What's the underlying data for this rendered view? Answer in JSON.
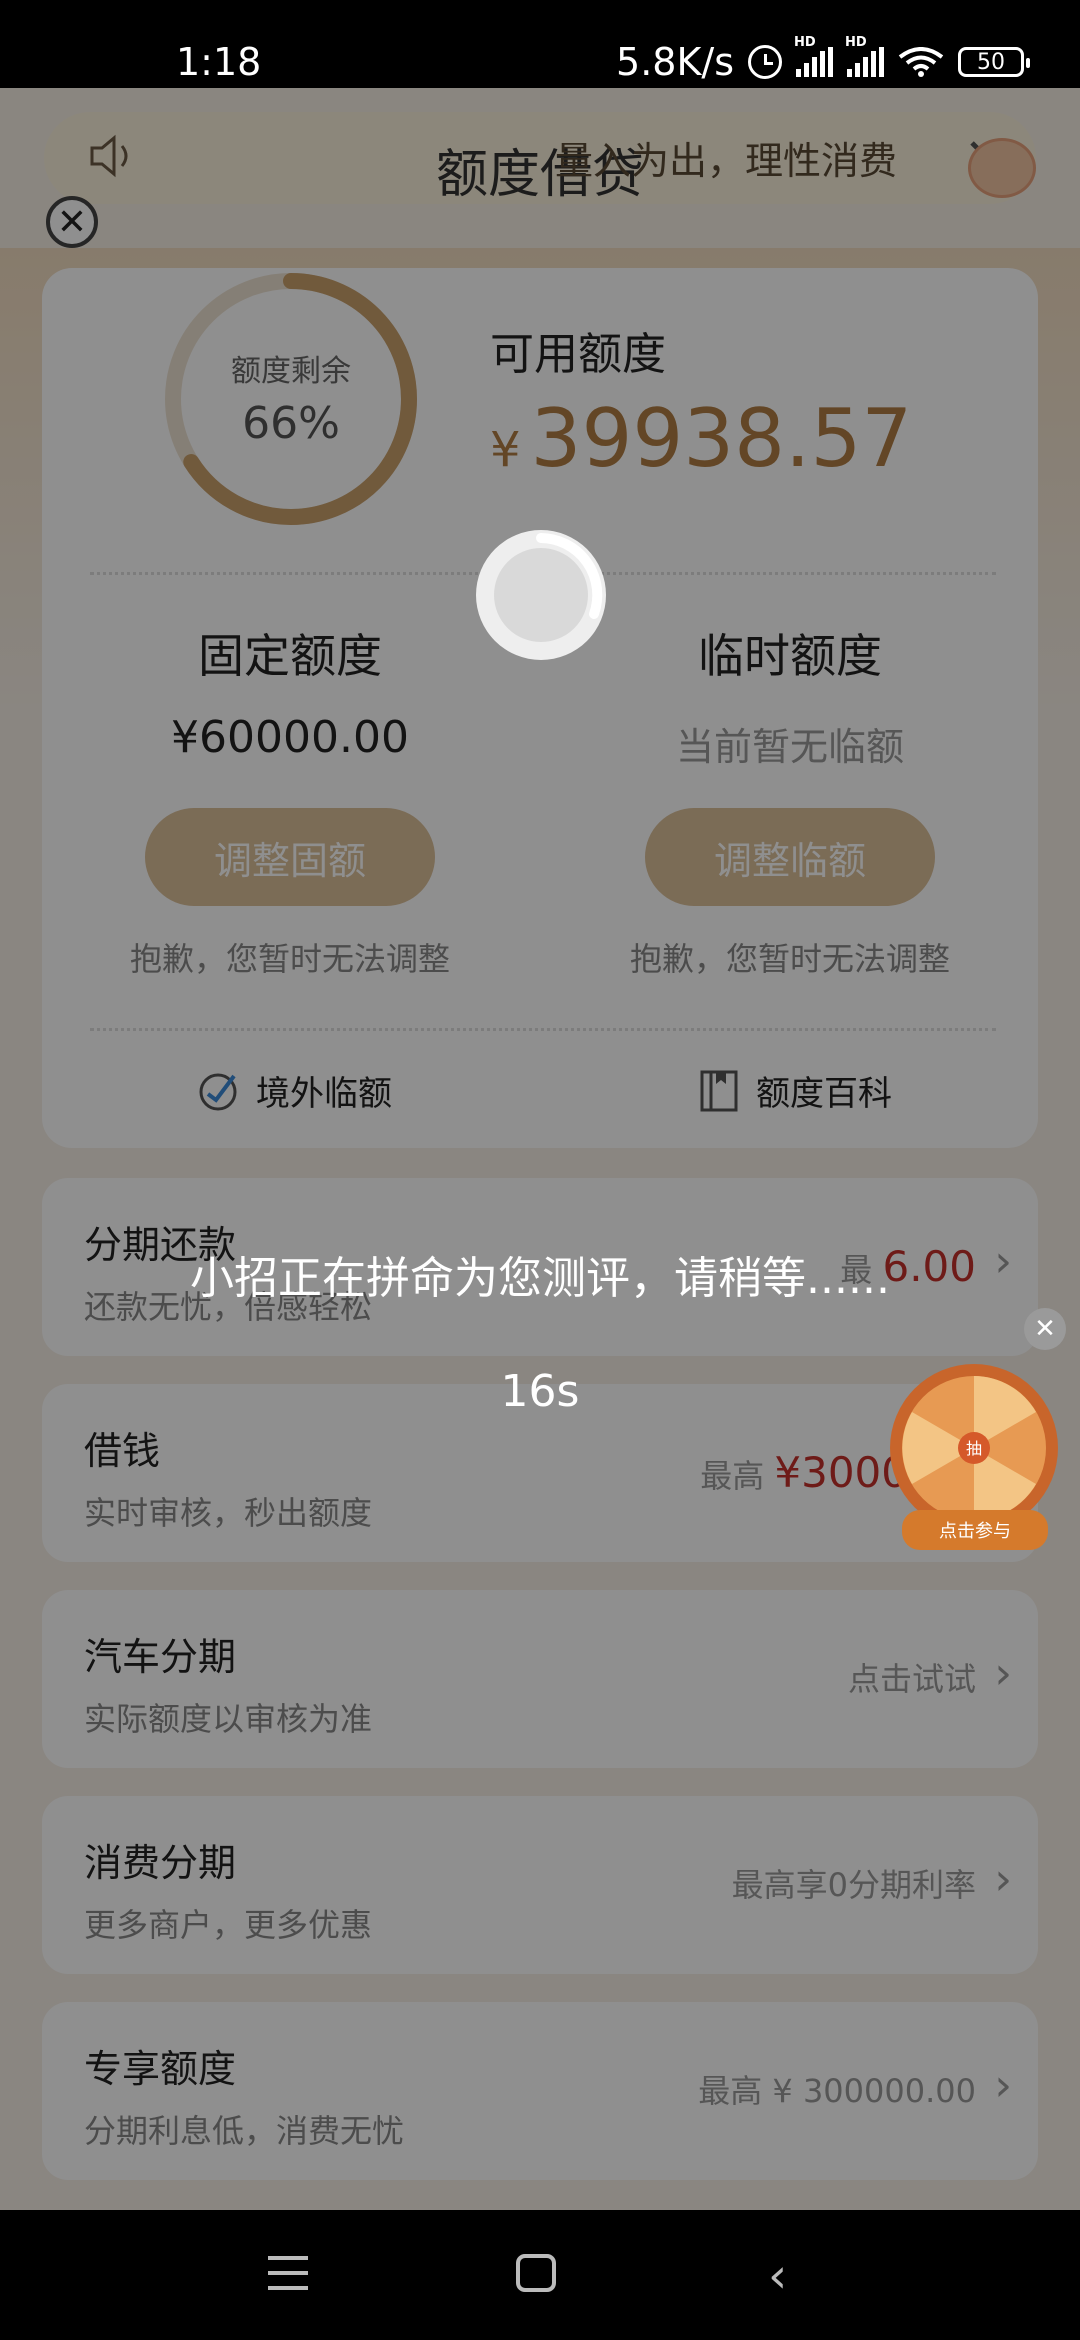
{
  "status_bar": {
    "time": "1:18",
    "net_speed": "5.8K/s",
    "battery": "50",
    "hd_label": "HD"
  },
  "header": {
    "title": "额度借贷",
    "notice": "量入为出，理性消费"
  },
  "quota": {
    "ring_label": "额度剩余",
    "ring_value": "66%",
    "ring_fraction": 0.66,
    "available_title": "可用额度",
    "available_currency": "¥",
    "available_value": "39938.57",
    "fixed": {
      "title": "固定额度",
      "value": "¥60000.00",
      "button": "调整固额",
      "note": "抱歉，您暂时无法调整"
    },
    "temporary": {
      "title": "临时额度",
      "value": "当前暂无临额",
      "button": "调整临额",
      "note": "抱歉，您暂时无法调整"
    },
    "shortcuts": {
      "overseas": "境外临额",
      "encyclopedia": "额度百科"
    }
  },
  "menu": [
    {
      "title": "分期还款",
      "subtitle": "还款无忧，倍感轻松",
      "right_prefix": "最",
      "right_value": "6.00"
    },
    {
      "title": "借钱",
      "subtitle": "实时审核，秒出额度",
      "right_prefix": "最高",
      "right_value": "¥3000"
    },
    {
      "title": "汽车分期",
      "subtitle": "实际额度以审核为准",
      "right_prefix": "点击试试",
      "right_value": ""
    },
    {
      "title": "消费分期",
      "subtitle": "更多商户，更多优惠",
      "right_prefix": "最高享0分期利率",
      "right_value": ""
    },
    {
      "title": "专享额度",
      "subtitle": "分期利息低，消费无忧",
      "right_prefix": "最高 ¥ 300000.00",
      "right_value": ""
    }
  ],
  "overlay": {
    "loading_text": "小招正在拼命为您测评，请稍等......",
    "countdown": "16s"
  },
  "wheel": {
    "center": "抽",
    "base_label": "点击参与"
  },
  "colors": {
    "accent": "#b07e44",
    "button": "#dcc09a",
    "highlight_red": "#c4302b"
  }
}
